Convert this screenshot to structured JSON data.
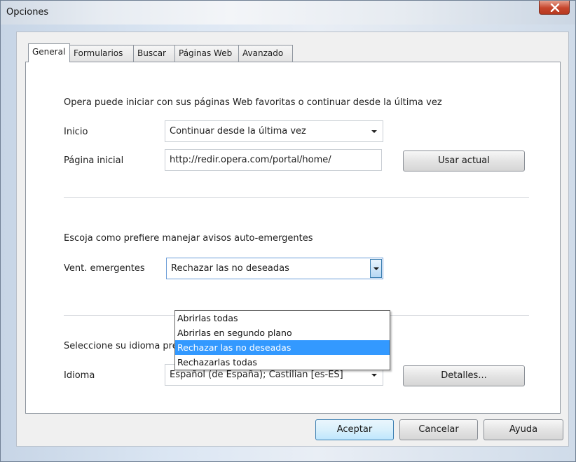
{
  "window": {
    "title": "Opciones"
  },
  "tabs": [
    {
      "label": "General",
      "active": true
    },
    {
      "label": "Formularios",
      "active": false
    },
    {
      "label": "Buscar",
      "active": false
    },
    {
      "label": "Páginas Web",
      "active": false
    },
    {
      "label": "Avanzado",
      "active": false
    }
  ],
  "startup": {
    "description": "Opera puede iniciar con sus páginas Web favoritas o continuar desde la última vez",
    "inicio_label": "Inicio",
    "inicio_value": "Continuar desde la última vez",
    "home_label": "Página inicial",
    "home_value": "http://redir.opera.com/portal/home/",
    "use_current_button": "Usar actual"
  },
  "popups": {
    "description": "Escoja como prefiere manejar avisos auto-emergentes",
    "label": "Vent. emergentes",
    "value": "Rechazar las no deseadas",
    "options": [
      "Abrirlas todas",
      "Abrirlas en segundo plano",
      "Rechazar las no deseadas",
      "Rechazarlas todas"
    ],
    "selected_index": 2
  },
  "language": {
    "description": "Seleccione su idioma preferido para Opera y las páginas Web",
    "label": "Idioma",
    "value": "Español (de España); Castilian [es-ES]",
    "details_button": "Detalles..."
  },
  "footer": {
    "accept_label": "Aceptar",
    "cancel_label": "Cancelar",
    "help_label": "Ayuda"
  },
  "colors": {
    "highlight": "#3399ff",
    "close_button": "#c6452c"
  }
}
